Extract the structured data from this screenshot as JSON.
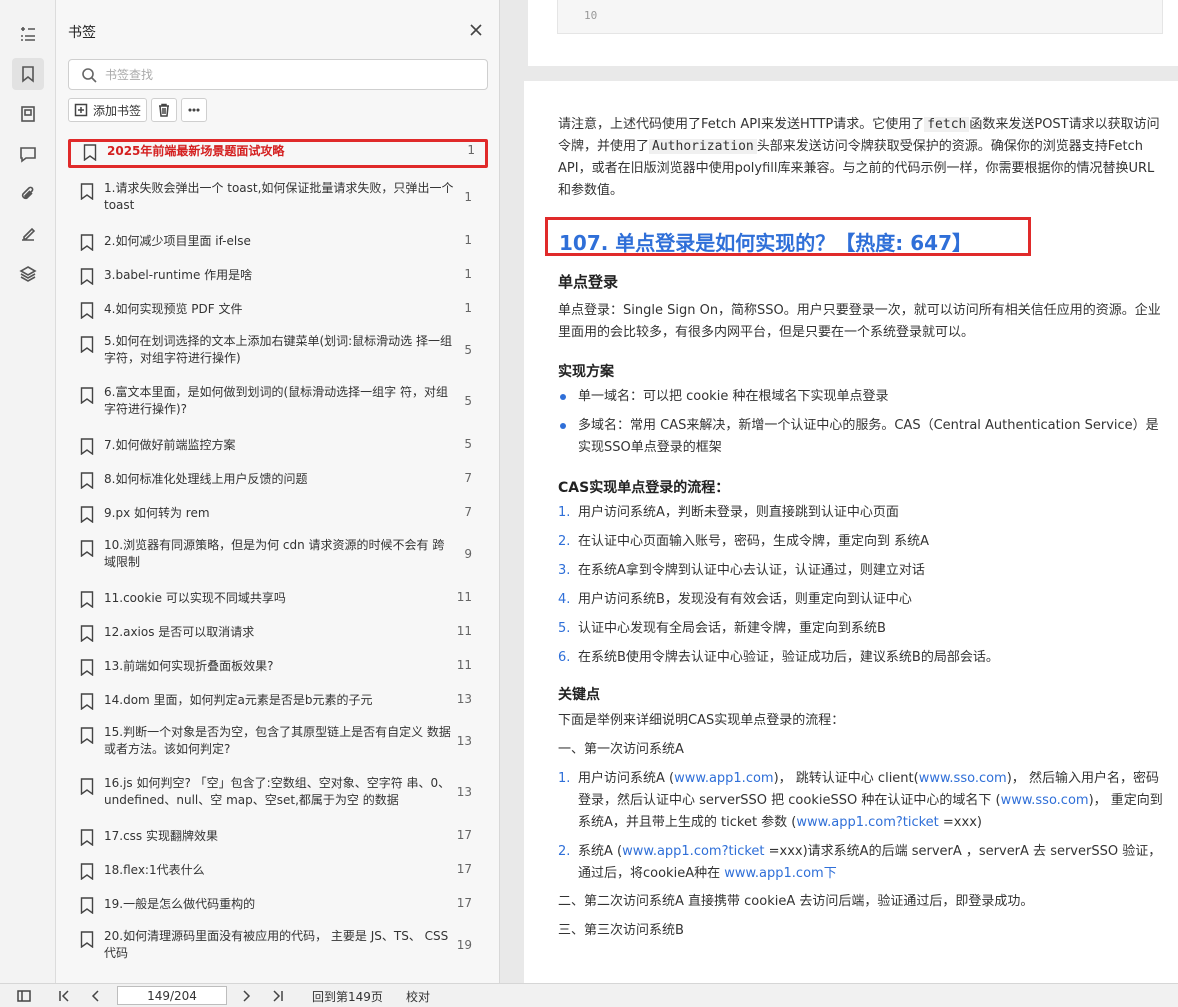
{
  "rail": {
    "icons": [
      "outline-icon",
      "bookmark-icon",
      "thumbnail-icon",
      "comment-icon",
      "attachment-icon",
      "signature-icon",
      "layers-icon"
    ]
  },
  "panel": {
    "title": "书签",
    "search_placeholder": "书签查找",
    "add_label": "添加书签",
    "bookmarks": [
      {
        "title": "2025年前端最新场景题面试攻略",
        "page": "1"
      },
      {
        "title": "1.请求失败会弹出一个 toast,如何保证批量请求失败，只弹出一个 toast",
        "page": "1"
      },
      {
        "title": "2.如何减少项目里面 if-else",
        "page": "1"
      },
      {
        "title": "3.babel-runtime 作用是啥",
        "page": "1"
      },
      {
        "title": "4.如何实现预览 PDF 文件",
        "page": "1"
      },
      {
        "title": "5.如何在划词选择的文本上添加右键菜单(划词:鼠标滑动选 择一组字符，对组字符进行操作)",
        "page": "5"
      },
      {
        "title": "6.富文本里面，是如何做到划词的(鼠标滑动选择一组字 符，对组字符进行操作)?",
        "page": "5"
      },
      {
        "title": "7.如何做好前端监控方案",
        "page": "5"
      },
      {
        "title": "8.如何标准化处理线上用户反馈的问题",
        "page": "7"
      },
      {
        "title": "9.px 如何转为 rem",
        "page": "7"
      },
      {
        "title": "10.浏览器有同源策略，但是为何 cdn 请求资源的时候不会有 跨域限制",
        "page": "9"
      },
      {
        "title": "11.cookie 可以实现不同域共享吗",
        "page": "11"
      },
      {
        "title": "12.axios 是否可以取消请求",
        "page": "11"
      },
      {
        "title": " 13.前端如何实现折叠面板效果?",
        "page": "11"
      },
      {
        "title": "14.dom 里面，如何判定a元素是否是b元素的子元",
        "page": "13"
      },
      {
        "title": "15.判断一个对象是否为空，包含了其原型链上是否有自定义 数据或者方法。该如何判定?",
        "page": "13"
      },
      {
        "title": "16.js 如何判空? 「空」包含了:空数组、空对象、空字符 串、0、undefined、null、空 map、空set,都属于为空 的数据",
        "page": "13"
      },
      {
        "title": "17.css 实现翻牌效果",
        "page": "17"
      },
      {
        "title": "18.flex:1代表什么",
        "page": "17"
      },
      {
        "title": "19.一般是怎么做代码重构的",
        "page": "17"
      },
      {
        "title": "20.如何清理源码里面没有被应用的代码， 主要是 JS、TS、 CSS 代码",
        "page": "19"
      }
    ]
  },
  "status": {
    "page_value": "149/204",
    "back_label": "回到第149页",
    "proof_label": "校对"
  },
  "doc": {
    "code_line_no": "10",
    "intro_a": "请注意，上述代码使用了Fetch API来发送HTTP请求。它使用了",
    "intro_code1": "fetch",
    "intro_b": "函数来发送POST请求以获取访问令牌，并使用了",
    "intro_code2": "Authorization",
    "intro_c": "头部来发送访问令牌获取受保护的资源。确保你的浏览器支持Fetch API，或者在旧版浏览器中使用polyfill库来兼容。与之前的代码示例一样，你需要根据你的情况替换URL和参数值。",
    "heading": "107. 单点登录是如何实现的？【热度: 647】",
    "sso_title": "单点登录",
    "sso_desc": "单点登录：Single Sign On，简称SSO。用户只要登录一次，就可以访问所有相关信任应用的资源。企业里面用的会比较多，有很多内网平台，但是只要在一个系统登录就可以。",
    "impl_title": "实现方案",
    "impl_items": [
      "单一域名：可以把 cookie 种在根域名下实现单点登录",
      "多域名：常用 CAS来解决，新增一个认证中心的服务。CAS（Central Authentication Service）是实现SSO单点登录的框架"
    ],
    "flow_title": "CAS实现单点登录的流程：",
    "flow_items": [
      "用户访问系统A，判断未登录，则直接跳到认证中心页面",
      "在认证中心页面输入账号，密码，生成令牌，重定向到 系统A",
      "在系统A拿到令牌到认证中心去认证，认证通过，则建立对话",
      "用户访问系统B，发现没有有效会话，则重定向到认证中心",
      "认证中心发现有全局会话，新建令牌，重定向到系统B",
      "在系统B使用令牌去认证中心验证，验证成功后，建议系统B的局部会话。"
    ],
    "key_title": "关键点",
    "key_desc": "下面是举例来详细说明CAS实现单点登录的流程：",
    "first_visit": "一、第一次访问系统A",
    "detail1_a": "用户访问系统A (",
    "detail1_link1": "www.app1.com",
    "detail1_b": ")， 跳转认证中心 client(",
    "detail1_link2": "www.sso.com",
    "detail1_c": ")， 然后输入用户名，密码登录，然后认证中心 serverSSO 把 cookieSSO 种在认证中心的域名下 (",
    "detail1_link3": "www.sso.com",
    "detail1_d": ")， 重定向到系统A，并且带上生成的 ticket 参数 (",
    "detail1_link4": "www.app1.com?ticket",
    "detail1_e": " =xxx)",
    "detail2_a": "系统A (",
    "detail2_link1": "www.app1.com?ticket",
    "detail2_b": " =xxx)请求系统A的后端 serverA ，serverA 去 serverSSO 验证，通过后，将cookieA种在 ",
    "detail2_link2": "www.app1.com下",
    "second_visit": "二、第二次访问系统A 直接携带 cookieA 去访问后端，验证通过后，即登录成功。",
    "third_visit": "三、第三次访问系统B"
  },
  "colors": {
    "accent": "#2f6fd8",
    "highlight_border": "#e02a2a",
    "selected_text": "#d42020"
  }
}
